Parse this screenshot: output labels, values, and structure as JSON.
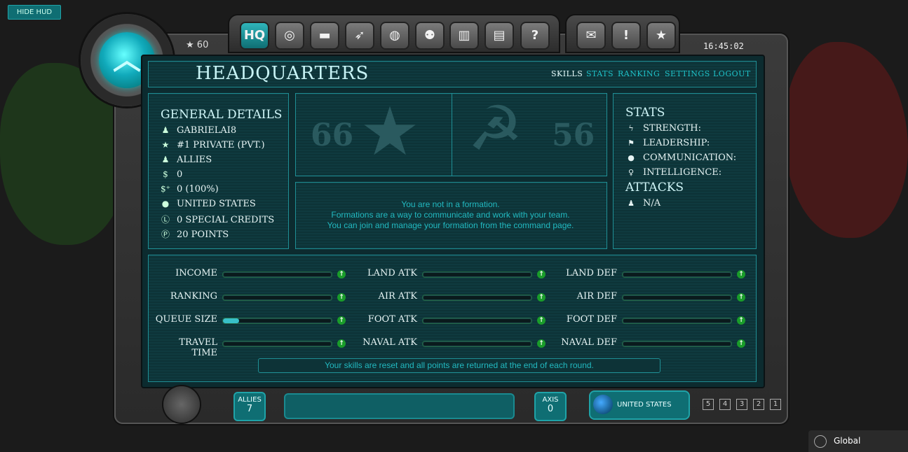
{
  "hud": {
    "hide_label": "HIDE HUD"
  },
  "header": {
    "rank_value": "60",
    "clock": "16:45:02",
    "nav_buttons": [
      {
        "icon": "hq-icon",
        "label": "HQ"
      },
      {
        "icon": "radar-icon",
        "label": ""
      },
      {
        "icon": "tank-icon",
        "label": ""
      },
      {
        "icon": "missile-icon",
        "label": ""
      },
      {
        "icon": "globe-icon",
        "label": ""
      },
      {
        "icon": "team-icon",
        "label": ""
      },
      {
        "icon": "podium-icon",
        "label": ""
      },
      {
        "icon": "chart-icon",
        "label": ""
      },
      {
        "icon": "help-icon",
        "label": "?"
      },
      {
        "icon": "mail-icon",
        "label": ""
      },
      {
        "icon": "alert-icon",
        "label": "!"
      },
      {
        "icon": "star-icon",
        "label": "★"
      }
    ]
  },
  "page": {
    "title": "HEADQUARTERS",
    "tabs": [
      "SKILLS",
      "STATS",
      "RANKING",
      "SETTINGS",
      "LOGOUT"
    ],
    "active_tab": "SKILLS"
  },
  "general": {
    "heading": "GENERAL DETAILS",
    "rows": [
      {
        "icon": "user-icon",
        "text": "GABRIELAI8"
      },
      {
        "icon": "star-icon",
        "text": "#1 PRIVATE (PVT.)"
      },
      {
        "icon": "user-icon",
        "text": "ALLIES"
      },
      {
        "icon": "dollar-icon",
        "text": "0"
      },
      {
        "icon": "dollar-plus-icon",
        "text": "0 (100%)"
      },
      {
        "icon": "globe-icon",
        "text": "UNITED STATES"
      },
      {
        "icon": "credit-icon",
        "text": "0 SPECIAL CREDITS"
      },
      {
        "icon": "points-icon",
        "text": "20 POINTS"
      }
    ]
  },
  "factions": {
    "allies_score": "66",
    "axis_score": "56"
  },
  "formation": {
    "lines": [
      "You are not in a formation.",
      "Formations are a way to communicate and work with your team.",
      "You can join and manage your formation from the command page."
    ]
  },
  "stats": {
    "heading": "STATS",
    "rows": [
      {
        "icon": "bolt-icon",
        "text": "STRENGTH:"
      },
      {
        "icon": "flag-icon",
        "text": "LEADERSHIP:"
      },
      {
        "icon": "chat-icon",
        "text": "COMMUNICATION:"
      },
      {
        "icon": "bulb-icon",
        "text": "INTELLIGENCE:"
      }
    ],
    "attacks_heading": "ATTACKS",
    "attacks_value": "N/A"
  },
  "skills": {
    "columns": [
      [
        {
          "label": "INCOME",
          "level": 0
        },
        {
          "label": "RANKING",
          "level": 0
        },
        {
          "label": "QUEUE SIZE",
          "level": 0.15
        },
        {
          "label": "TRAVEL TIME",
          "level": 0
        }
      ],
      [
        {
          "label": "LAND ATK",
          "level": 0
        },
        {
          "label": "AIR ATK",
          "level": 0
        },
        {
          "label": "FOOT ATK",
          "level": 0
        },
        {
          "label": "NAVAL ATK",
          "level": 0
        }
      ],
      [
        {
          "label": "LAND DEF",
          "level": 0
        },
        {
          "label": "AIR DEF",
          "level": 0
        },
        {
          "label": "FOOT DEF",
          "level": 0
        },
        {
          "label": "NAVAL DEF",
          "level": 0
        }
      ]
    ],
    "reset_note": "Your skills are reset and all points are returned at the end of each round."
  },
  "footer": {
    "allies_label": "ALLIES",
    "allies_count": "7",
    "axis_label": "AXIS",
    "axis_count": "0",
    "country": "UNITED STATES",
    "numbers": [
      "5",
      "4",
      "3",
      "2",
      "1"
    ]
  },
  "chat": {
    "channel": "Global"
  }
}
